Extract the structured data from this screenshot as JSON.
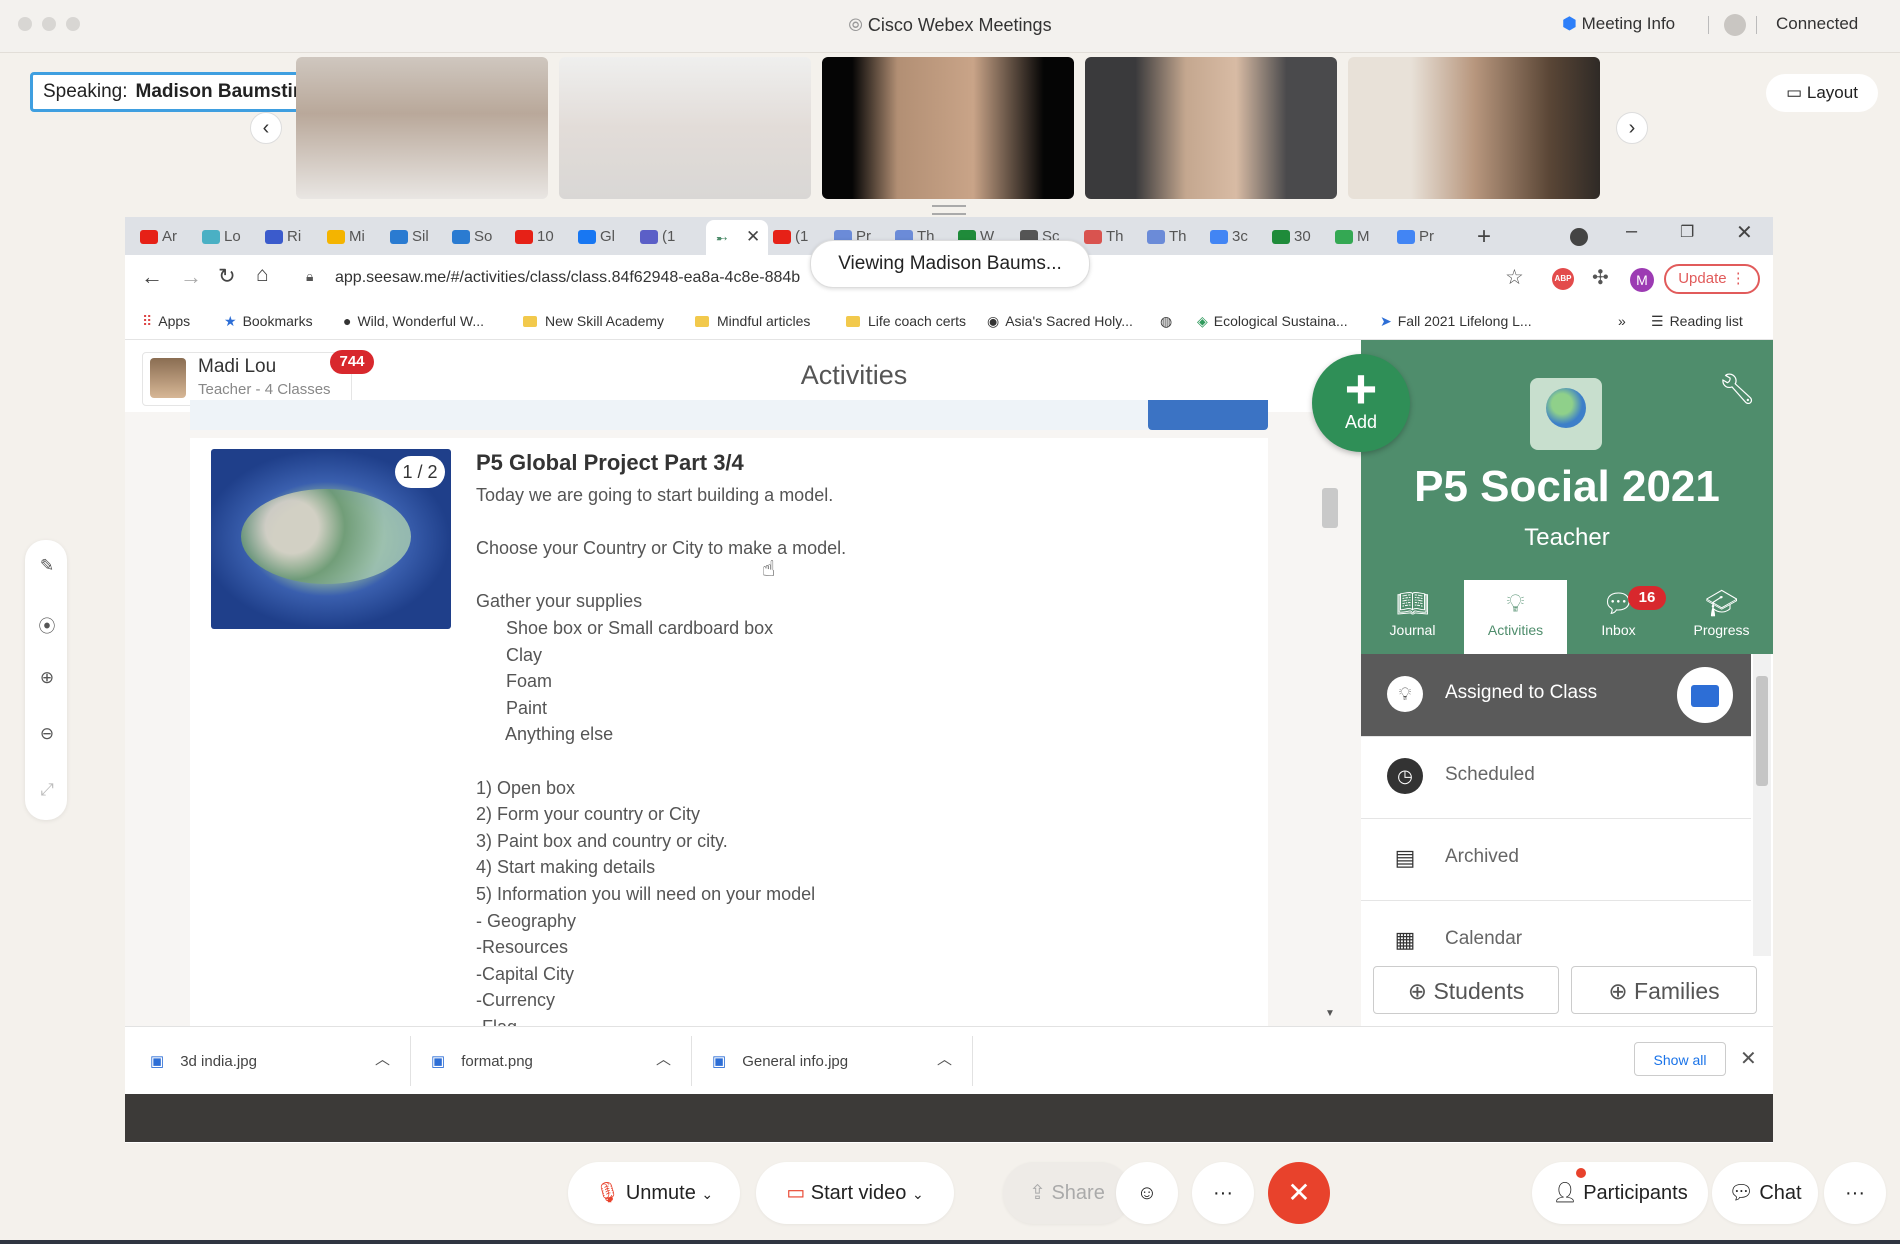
{
  "window": {
    "title": "Cisco Webex Meetings",
    "meeting_info": "Meeting Info",
    "status": "Connected"
  },
  "speaking": {
    "label": "Speaking:",
    "name": "Madison Baumstimler (Coh..."
  },
  "layout_button": "Layout",
  "viewing_badge": "Viewing Madison Baums...",
  "browser": {
    "tabs": [
      "Ar",
      "Lo",
      "Ri",
      "Mi",
      "Sil",
      "So",
      "10",
      "Gl",
      "(1",
      "",
      "(1",
      "Pr",
      "Th",
      "W",
      "Sc",
      "Th",
      "Th",
      "3c",
      "30",
      "M",
      "Pr"
    ],
    "url": "app.seesaw.me/#/activities/class/class.84f62948-ea8a-4c8e-884b",
    "update_label": "Update",
    "bookmarks": [
      "Apps",
      "Bookmarks",
      "Wild, Wonderful W...",
      "New Skill Academy",
      "Mindful articles",
      "Life coach certs",
      "Asia's Sacred Holy...",
      "Ecological Sustaina...",
      "Fall 2021 Lifelong L...",
      "Reading list"
    ],
    "bookmarks_more": "»"
  },
  "seesaw": {
    "user_name": "Madi Lou",
    "user_role": "Teacher - 4 Classes",
    "notification_count": "744",
    "page_title": "Activities",
    "add_label": "Add",
    "post": {
      "image_counter": "1 / 2",
      "title": "P5 Global Project Part 3/4",
      "lines": [
        "Today we are going to start building a model.",
        "",
        "Choose your Country or City to make a model.",
        "",
        "Gather your supplies",
        "      Shoe box or Small cardboard box",
        "      Clay",
        "      Foam",
        "      Paint",
        "      Anything else",
        "",
        "1) Open box",
        "2) Form your country or City",
        "3) Paint box and country or city.",
        "4) Start making details",
        "5) Information you will need on your model",
        "- Geography",
        "-Resources",
        "-Capital City",
        "-Currency",
        "-Flag"
      ]
    },
    "class": {
      "name": "P5 Social 2021",
      "role": "Teacher"
    },
    "nav_tabs": [
      {
        "label": "Journal",
        "icon": "book-icon"
      },
      {
        "label": "Activities",
        "icon": "lightbulb-icon"
      },
      {
        "label": "Inbox",
        "icon": "chat-bubble-icon"
      },
      {
        "label": "Progress",
        "icon": "graduation-cap-icon"
      }
    ],
    "inbox_count": "16",
    "folders": [
      {
        "label": "Assigned to Class",
        "icon": "lightbulb-icon"
      },
      {
        "label": "Scheduled",
        "icon": "clock-icon"
      },
      {
        "label": "Archived",
        "icon": "archive-icon"
      },
      {
        "label": "Calendar",
        "icon": "calendar-icon"
      }
    ],
    "students_label": "Students",
    "families_label": "Families"
  },
  "downloads": [
    {
      "name": "3d india.jpg"
    },
    {
      "name": "format.png"
    },
    {
      "name": "General info.jpg"
    }
  ],
  "downloads_show_all": "Show all",
  "controls": {
    "unmute": "Unmute",
    "start_video": "Start video",
    "share": "Share",
    "participants": "Participants",
    "chat": "Chat",
    "more": "···"
  },
  "colors": {
    "seesaw_green": "#4f8d6c",
    "badge_red": "#d8282d",
    "end_call": "#e8422c",
    "speaking_border": "#3f9fe0"
  }
}
